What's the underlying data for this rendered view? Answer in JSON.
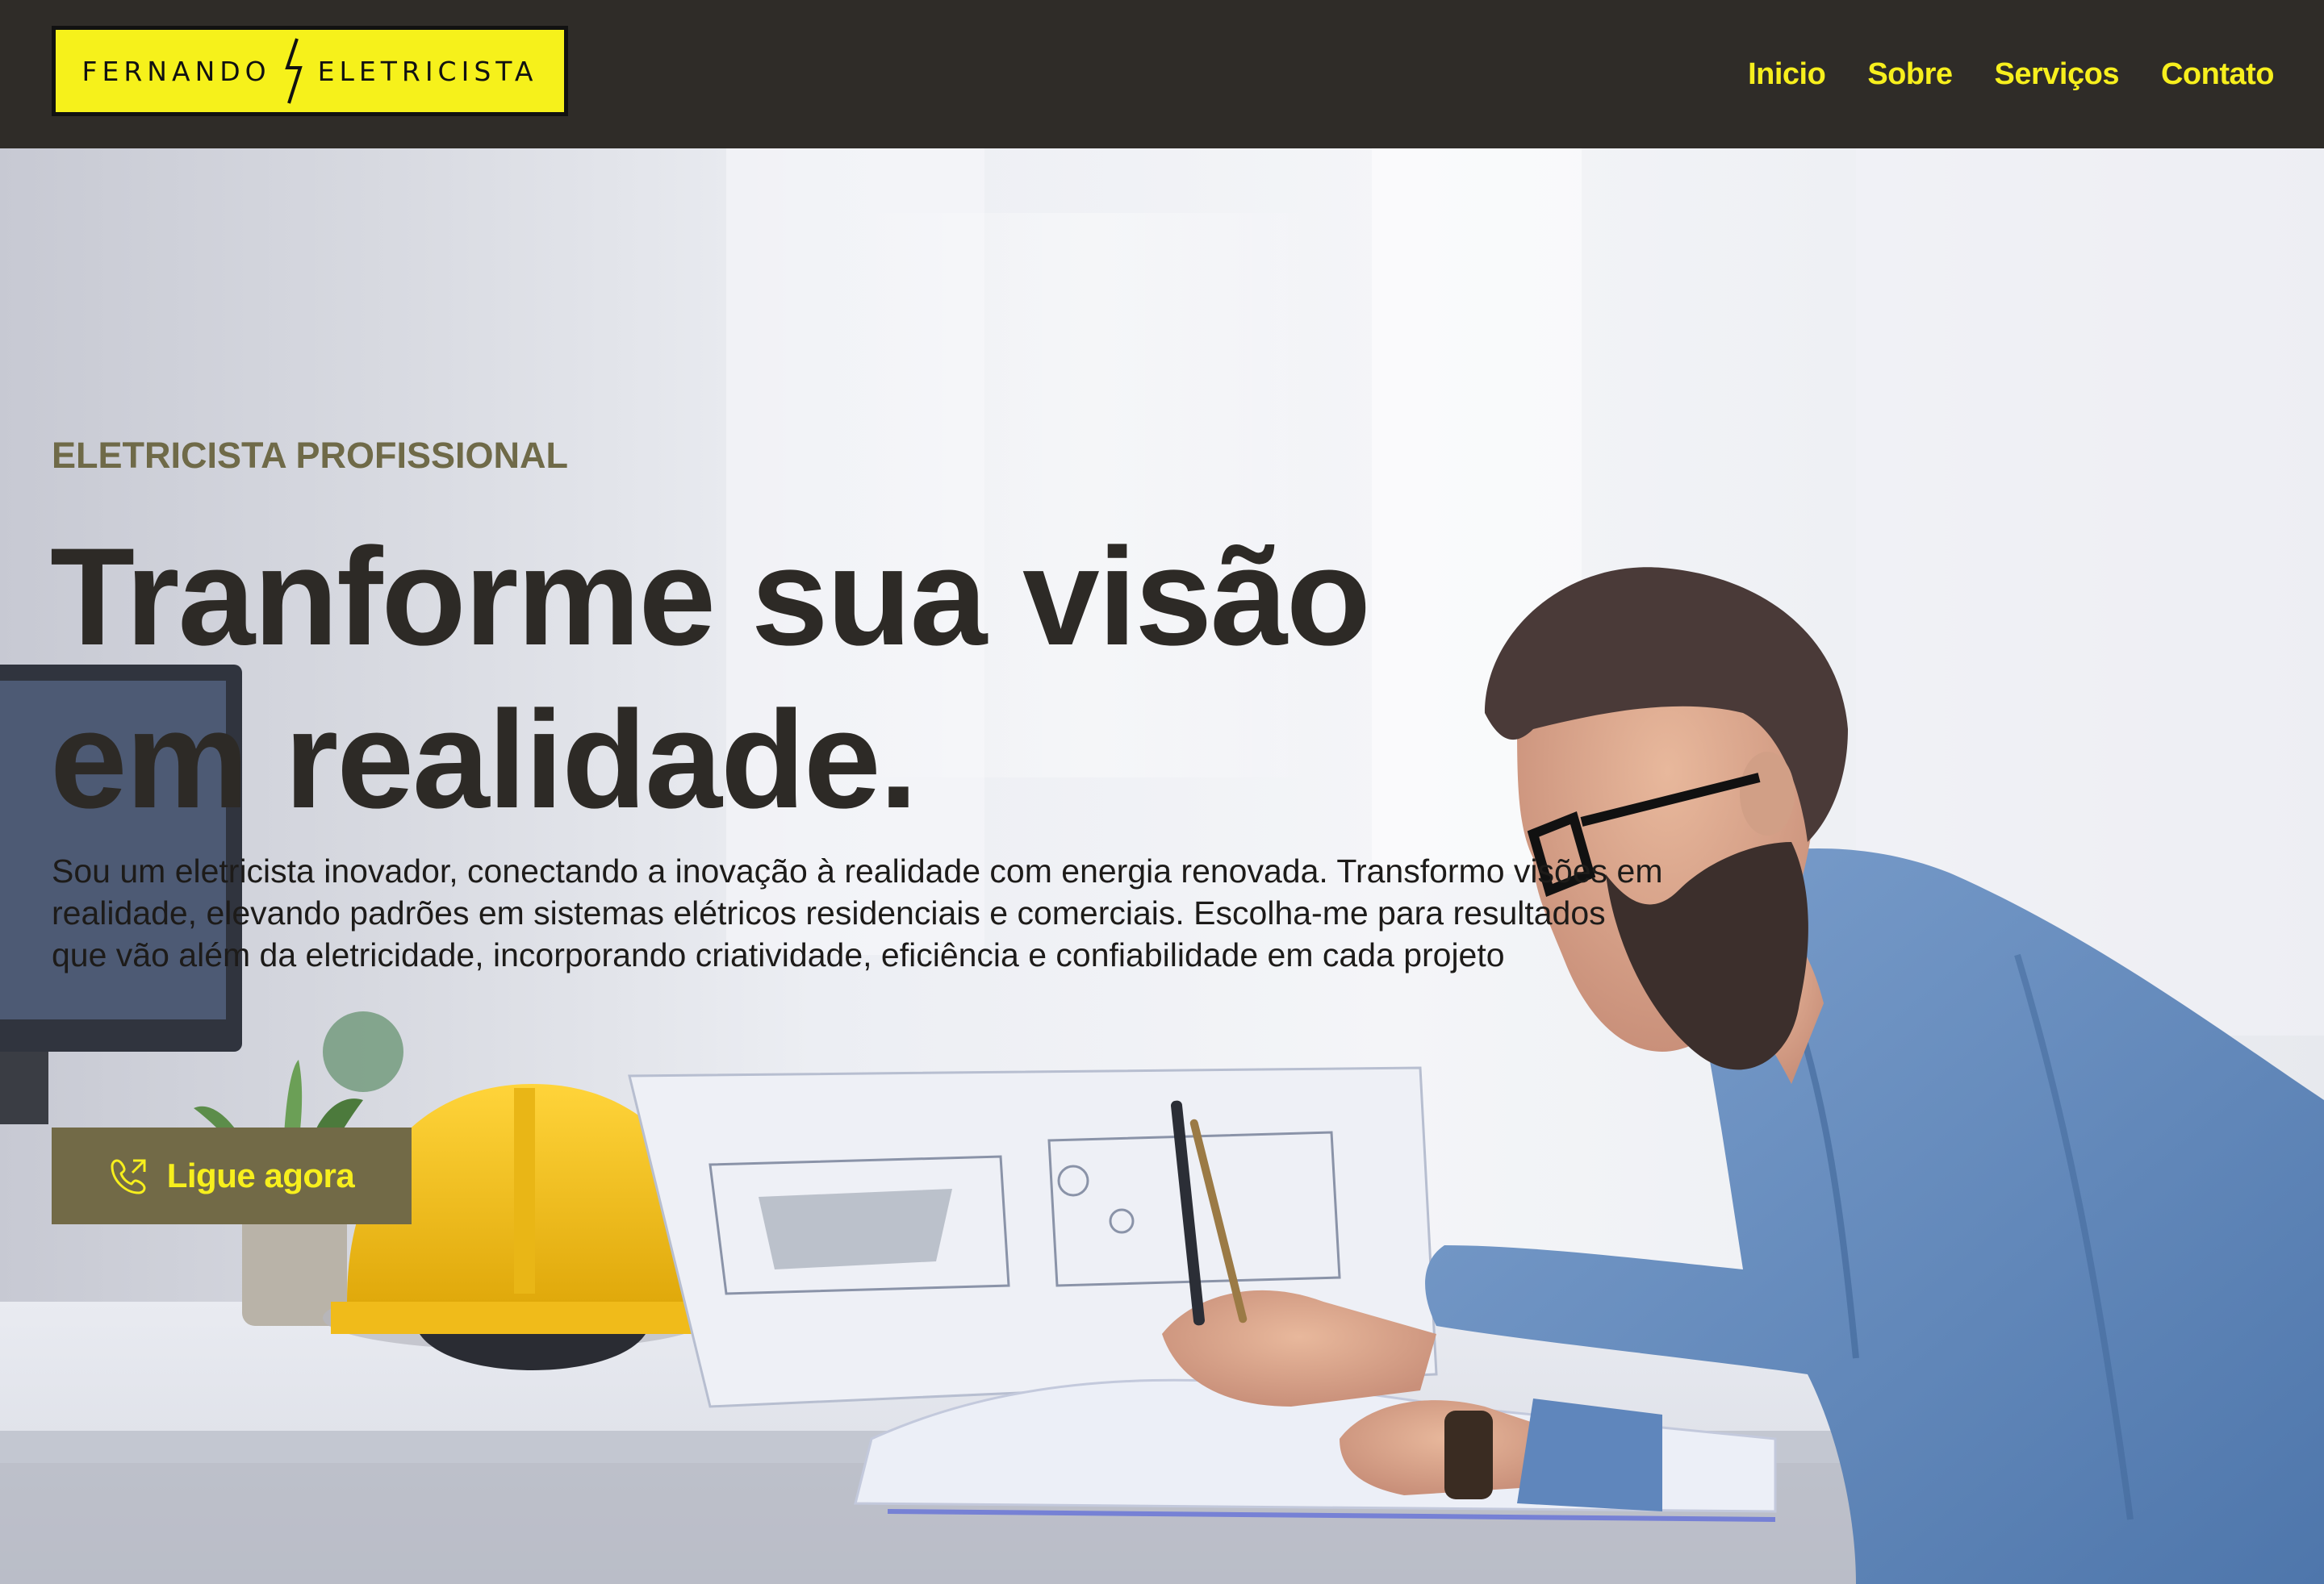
{
  "header": {
    "logo": {
      "left": "FERNANDO",
      "right": "ELETRICISTA"
    },
    "nav": [
      {
        "label": "Inicio"
      },
      {
        "label": "Sobre"
      },
      {
        "label": "Serviços"
      },
      {
        "label": "Contato"
      }
    ]
  },
  "hero": {
    "eyebrow": "ELETRICISTA PROFISSIONAL",
    "headline": "Tranforme sua visão em realidade.",
    "lead": "Sou um eletricista inovador, conectando a inovação à realidade com energia renovada. Transformo visões em realidade, elevando padrões em sistemas elétricos residenciais e comerciais. Escolha-me para resultados que vão além da eletricidade, incorporando criatividade, eficiência e confiabilidade em cada projeto",
    "cta": {
      "label": "Ligue agora",
      "icon": "phone-call-icon"
    }
  },
  "colors": {
    "header_bg": "#2f2c28",
    "logo_bg": "#f6f11b",
    "nav_text": "#f7ef1d",
    "eyebrow": "#6f6a48",
    "headline": "#2d2a26",
    "cta_bg": "#726a47",
    "cta_text": "#f7ef1d"
  }
}
